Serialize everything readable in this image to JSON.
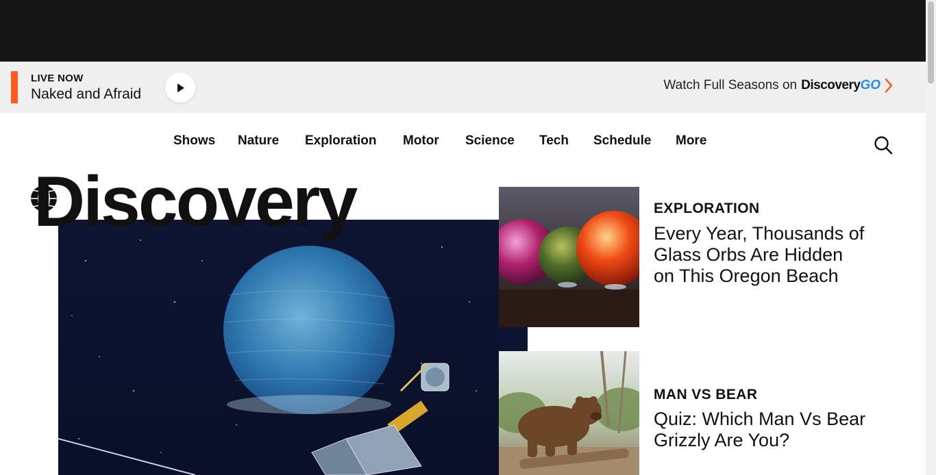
{
  "ad": {},
  "live_bar": {
    "label": "LIVE NOW",
    "show": "Naked and Afraid",
    "promo_text": "Watch Full Seasons on",
    "promo_brand": "Discovery",
    "promo_brand_suffix": "GO",
    "accent_color": "#ff5a1f",
    "brand_color": "#1a8ff0"
  },
  "nav": {
    "items": [
      "Shows",
      "Nature",
      "Exploration",
      "Motor",
      "Science",
      "Tech",
      "Schedule",
      "More"
    ]
  },
  "brand": {
    "name": "Discovery"
  },
  "cards": [
    {
      "category": "EXPLORATION",
      "title": "Every Year, Thousands of Glass Orbs Are Hidden on This Oregon Beach"
    },
    {
      "category": "MAN VS BEAR",
      "title": "Quiz: Which Man Vs Bear Grizzly Are You?"
    }
  ]
}
